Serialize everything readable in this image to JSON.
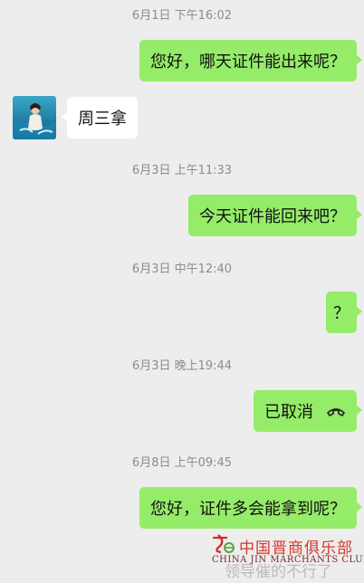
{
  "messages": [
    {
      "type": "time",
      "text": "6月1日 下午16:02"
    },
    {
      "type": "sent",
      "text": "您好，哪天证件能出来呢？"
    },
    {
      "type": "received",
      "text": "周三拿",
      "avatar": "avatar-photo"
    },
    {
      "type": "time",
      "text": "6月3日 上午11:33"
    },
    {
      "type": "sent",
      "text": "今天证件能回来吧？"
    },
    {
      "type": "time",
      "text": "6月3日 中午12:40"
    },
    {
      "type": "sent",
      "text": "？"
    },
    {
      "type": "time",
      "text": "6月3日 晚上19:44"
    },
    {
      "type": "sent-call",
      "text": "已取消",
      "icon": "phone-hangup-icon"
    },
    {
      "type": "time",
      "text": "6月8日 上午09:45"
    },
    {
      "type": "sent",
      "text": "您好，证件多会能拿到呢？"
    }
  ],
  "watermark": {
    "cn": "中国晋商俱乐部",
    "en": "CHINA JIN MARCHANTS CLUB",
    "logo": "club-logo"
  },
  "partial_message": "领导催的不行了",
  "colors": {
    "background": "#ededed",
    "sent_bubble": "#95ec69",
    "received_bubble": "#ffffff",
    "timestamp": "#8c8c8c",
    "watermark": "#d7362a"
  }
}
